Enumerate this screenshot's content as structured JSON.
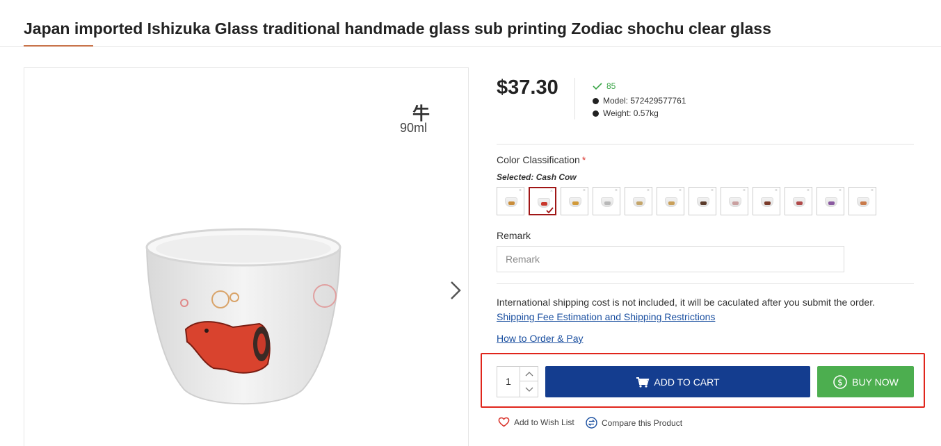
{
  "product": {
    "title": "Japan imported Ishizuka Glass traditional handmade glass sub printing Zodiac shochu clear glass",
    "price": "$37.30",
    "sold": "85",
    "model": "Model: 572429577761",
    "weight": "Weight: 0.57kg"
  },
  "gallery": {
    "zodiac_char": "牛",
    "volume": "90ml",
    "next_icon": "chevron-right-icon"
  },
  "variants": {
    "label": "Color Classification",
    "required_mark": "*",
    "selected_prefix": "Selected: ",
    "selected_value": "Cash Cow",
    "swatch_count": 12,
    "selected_index": 1,
    "swatch_marks": [
      "#c98d3a",
      "#c8372c",
      "#d19a3a",
      "#b8b8b8",
      "#c4a56a",
      "#c9a05a",
      "#5a3a2a",
      "#c9a0a0",
      "#7a3a2a",
      "#b04a4a",
      "#8a5aa0",
      "#c97a4a"
    ]
  },
  "remark": {
    "label": "Remark",
    "placeholder": "Remark"
  },
  "shipping": {
    "note": "International shipping cost is not included, it will be caculated after you submit the order.",
    "fee_link": "Shipping Fee Estimation and Shipping Restrictions",
    "howto_link": "How to Order & Pay"
  },
  "actions": {
    "quantity": "1",
    "add_to_cart": "ADD TO CART",
    "buy_now": "BUY NOW",
    "cart_icon": "cart-icon",
    "buy_icon": "dollar-circle-icon",
    "wish_list": "Add to Wish List",
    "compare": "Compare this Product",
    "colors": {
      "cart": "#143d8f",
      "buy": "#4cae4f",
      "highlight": "#e0251b",
      "link": "#1a4fa0",
      "selected_border": "#a01616"
    }
  }
}
